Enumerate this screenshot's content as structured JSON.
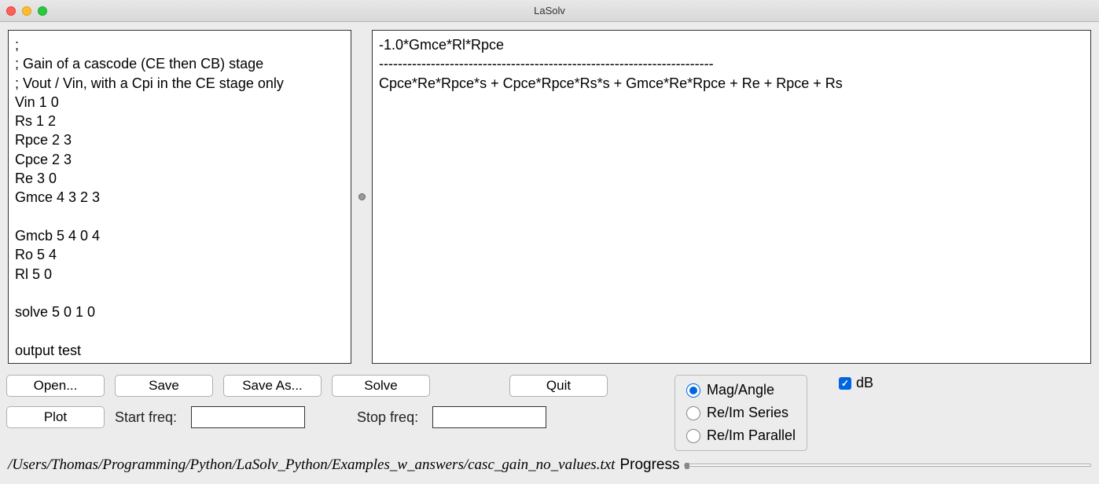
{
  "window": {
    "title": "LaSolv"
  },
  "editor": {
    "content": ";\n; Gain of a cascode (CE then CB) stage\n; Vout / Vin, with a Cpi in the CE stage only\nVin 1 0\nRs 1 2\nRpce 2 3\nCpce 2 3\nRe 3 0\nGmce 4 3 2 3\n\nGmcb 5 4 0 4\nRo 5 4\nRl 5 0\n\nsolve 5 0 1 0\n\noutput test"
  },
  "output": {
    "content": "-1.0*Gmce*Rl*Rpce\n-----------------------------------------------------------------------\nCpce*Re*Rpce*s + Cpce*Rpce*Rs*s + Gmce*Re*Rpce + Re + Rpce + Rs"
  },
  "buttons": {
    "open": "Open...",
    "save": "Save",
    "saveas": "Save As...",
    "solve": "Solve",
    "quit": "Quit",
    "plot": "Plot"
  },
  "freq": {
    "start_label": "Start freq:",
    "stop_label": "Stop freq:",
    "start_value": "",
    "stop_value": ""
  },
  "radios": {
    "mag_angle": "Mag/Angle",
    "reim_series": "Re/Im Series",
    "reim_parallel": "Re/Im Parallel",
    "selected": "mag_angle"
  },
  "checkbox": {
    "db_label": "dB",
    "db_checked": true
  },
  "status": {
    "filepath": "/Users/Thomas/Programming/Python/LaSolv_Python/Examples_w_answers/casc_gain_no_values.txt",
    "progress_label": "Progress"
  }
}
